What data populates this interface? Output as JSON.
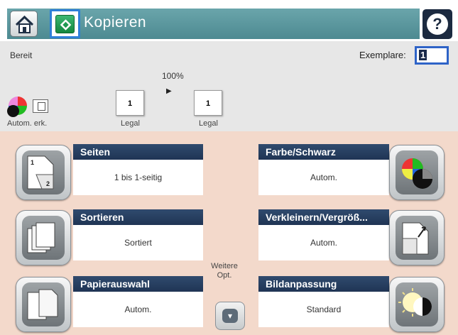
{
  "header": {
    "title": "Kopieren",
    "home_icon": "home-icon",
    "start_icon": "start-copy-icon",
    "help_label": "?"
  },
  "status": {
    "text": "Bereit",
    "copies_label": "Exemplare:",
    "copies_value": "1",
    "scale": "100%",
    "arrow": "▶",
    "source_page": "1",
    "dest_page": "1",
    "source_paper": "Legal",
    "dest_paper": "Legal",
    "autodetect_label": "Autom. erk."
  },
  "options": {
    "seiten": {
      "title": "Seiten",
      "value": "1 bis 1-seitig"
    },
    "farbe": {
      "title": "Farbe/Schwarz",
      "value": "Autom."
    },
    "sortieren": {
      "title": "Sortieren",
      "value": "Sortiert"
    },
    "verkleinern": {
      "title": "Verkleinern/Vergröß...",
      "value": "Autom."
    },
    "papier": {
      "title": "Papierauswahl",
      "value": "Autom."
    },
    "bild": {
      "title": "Bildanpassung",
      "value": "Standard"
    },
    "more": {
      "label": "Weitere Opt.",
      "chevron": "▾"
    }
  },
  "colors": {
    "teal": "#5b9aa0",
    "header_blue": "#243a5e",
    "options_bg": "#f3d9cb",
    "status_bg": "#e7e7e7",
    "start_green": "#1f9a51"
  }
}
